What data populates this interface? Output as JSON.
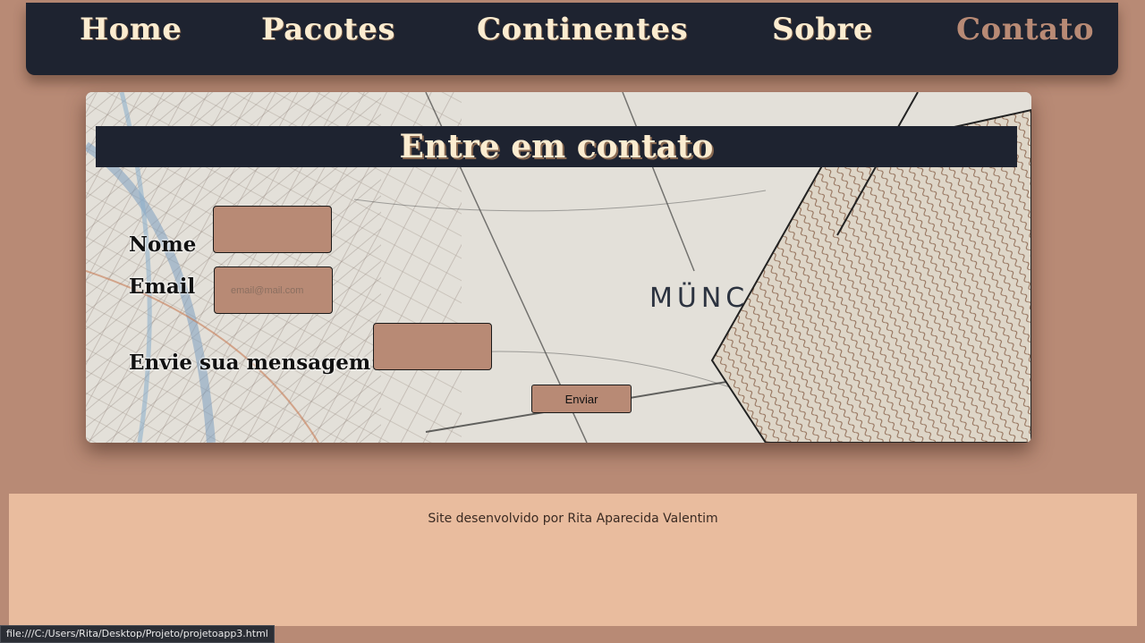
{
  "nav": {
    "items": [
      {
        "label": "Home"
      },
      {
        "label": "Pacotes"
      },
      {
        "label": "Continentes"
      },
      {
        "label": "Sobre"
      },
      {
        "label": "Contato"
      }
    ],
    "active": "Contato"
  },
  "contact": {
    "title": "Entre em contato",
    "name_label": "Nome",
    "name_value": "",
    "email_label": "Email",
    "email_placeholder": "email@mail.com",
    "message_label": "Envie sua mensagem",
    "message_value": "",
    "submit_label": "Enviar",
    "map_text": "MÜNC"
  },
  "footer": {
    "text": "Site desenvolvido por Rita Aparecida Valentim"
  },
  "status_bar": {
    "url": "file:///C:/Users/Rita/Desktop/Projeto/projetoapp3.html"
  },
  "colors": {
    "page_bg": "#b88a75",
    "nav_bg": "#1e2330",
    "nav_text": "#fbecd0",
    "nav_active": "#b88a75",
    "footer_bg": "#e9bc9e"
  }
}
